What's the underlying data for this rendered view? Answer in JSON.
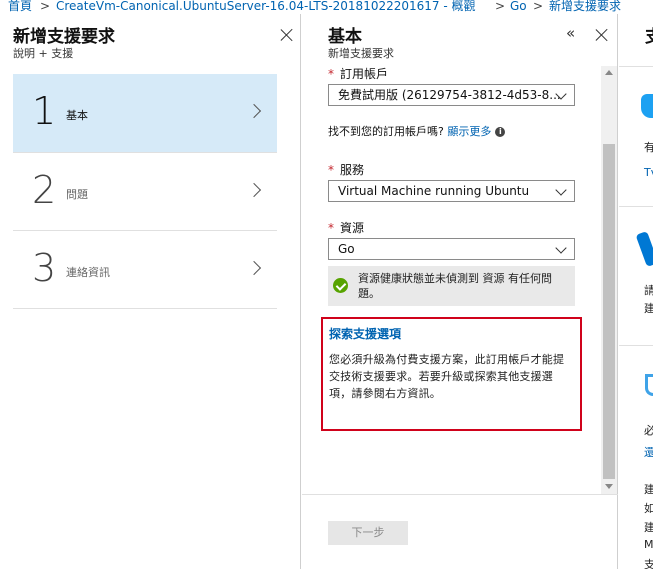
{
  "breadcrumb": {
    "items": [
      "首頁",
      "CreateVm-Canonical.UbuntuServer-16.04-LTS-20181022201617 - 概觀",
      "Go",
      "新增支援要求"
    ],
    "separator": ">"
  },
  "panel1": {
    "title": "新增支援要求",
    "subtitle": "說明 + 支援",
    "steps": [
      {
        "number": "1",
        "label": "基本"
      },
      {
        "number": "2",
        "label": "問題"
      },
      {
        "number": "3",
        "label": "連絡資訊"
      }
    ]
  },
  "panel2": {
    "title": "基本",
    "subtitle": "新增支援要求",
    "subscription": {
      "label": "訂用帳戶",
      "value": "免費試用版 (26129754-3812-4d53-8..."
    },
    "subscription_help": {
      "text": "找不到您的訂用帳戶嗎?",
      "link": "顯示更多"
    },
    "service": {
      "label": "服務",
      "value": "Virtual Machine running Ubuntu"
    },
    "resource": {
      "label": "資源",
      "value": "Go"
    },
    "health_message": "資源健康狀態並未偵測到 資源 有任何問題。",
    "explore": {
      "title": "探索支援選項",
      "body": "您必須升級為付費支援方案，此訂用帳戶才能提交技術支援要求。若要升級或探索其他支援選項，請參閱右方資訊。"
    },
    "next_button": "下一步"
  },
  "panel3": {
    "title_fragment": "支",
    "texts": [
      "有",
      "Tv",
      "請",
      "建",
      "必",
      "還",
      "建",
      "如",
      "建",
      "M",
      "支"
    ]
  },
  "colors": {
    "accent": "#0063b1",
    "active_step_bg": "#d6eaf8",
    "required": "#c4262e",
    "highlight_border": "#d0021b",
    "success": "#57a300"
  }
}
